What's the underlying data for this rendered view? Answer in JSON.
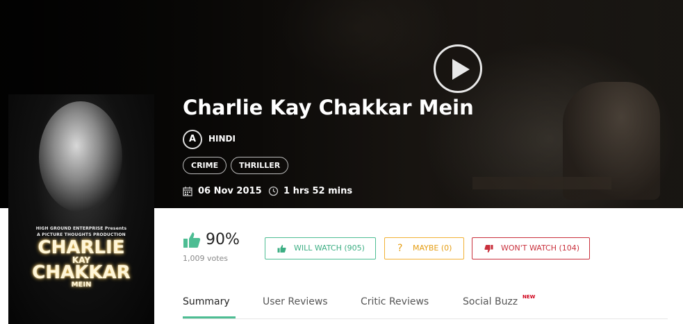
{
  "movie": {
    "title": "Charlie Kay Chakkar Mein",
    "certificate": "A",
    "language": "HINDI",
    "genres": [
      "CRIME",
      "THRILLER"
    ],
    "release_date": "06 Nov 2015",
    "duration": "1 hrs 52 mins"
  },
  "poster": {
    "presenter": "HIGH GROUND ENTERPRISE Presents",
    "production": "A PICTURE THOUGHTS PRODUCTION",
    "title_line1": "CHARLIE",
    "title_line2": "KAY",
    "title_line3": "CHAKKAR",
    "title_line4": "MEIN"
  },
  "rating": {
    "percent": "90%",
    "votes": "1,009 votes"
  },
  "vote_buttons": {
    "will_watch": "WILL WATCH (905)",
    "maybe": "MAYBE (0)",
    "wont_watch": "WON'T WATCH (104)"
  },
  "tabs": [
    {
      "label": "Summary",
      "active": true
    },
    {
      "label": "User Reviews"
    },
    {
      "label": "Critic Reviews"
    },
    {
      "label": "Social Buzz",
      "badge": "NEW"
    }
  ],
  "colors": {
    "accent_green": "#4dbd93",
    "maybe_orange": "#f2b134",
    "wont_red": "#c9303c",
    "new_badge": "#d0021b"
  },
  "icons": {
    "play": "play-icon",
    "calendar": "calendar-icon",
    "clock": "clock-icon",
    "thumbs_up": "thumbs-up-icon",
    "question": "question-mark-icon",
    "thumbs_down": "thumbs-down-icon"
  }
}
